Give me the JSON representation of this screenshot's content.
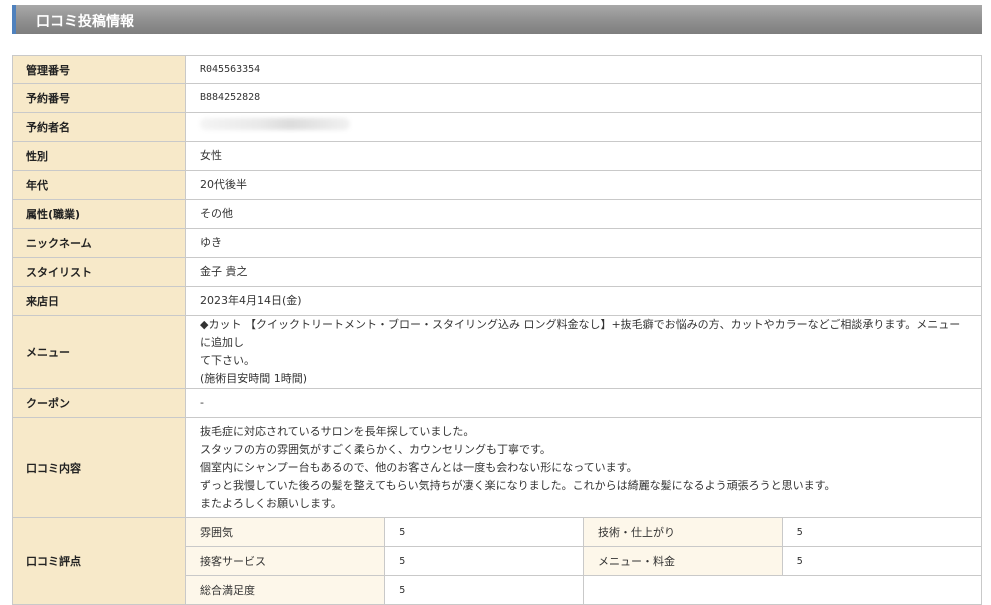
{
  "header": {
    "title": "口コミ投稿情報"
  },
  "rows": {
    "kanri": {
      "label": "管理番号",
      "value": "R045563354"
    },
    "yoyaku_no": {
      "label": "予約番号",
      "value": "B884252828"
    },
    "yoyaku_name": {
      "label": "予約者名"
    },
    "gender": {
      "label": "性別",
      "value": "女性"
    },
    "age": {
      "label": "年代",
      "value": "20代後半"
    },
    "occupation": {
      "label": "属性(職業)",
      "value": "その他"
    },
    "nickname": {
      "label": "ニックネーム",
      "value": "ゆき"
    },
    "stylist": {
      "label": "スタイリスト",
      "value": "金子 貴之"
    },
    "visit_date": {
      "label": "来店日",
      "value": "2023年4月14日(金)"
    },
    "menu": {
      "label": "メニュー",
      "line1": "◆カット 【クイックトリートメント・ブロー・スタイリング込み ロング料金なし】+抜毛癖でお悩みの方、カットやカラーなどご相談承ります。メニューに追加し",
      "line2": "て下さい。",
      "line3": "(施術目安時間 1時間)"
    },
    "coupon": {
      "label": "クーポン",
      "value": "-"
    },
    "review": {
      "label": "口コミ内容",
      "lines": [
        "抜毛症に対応されているサロンを長年探していました。",
        "スタッフの方の雰囲気がすごく柔らかく、カウンセリングも丁寧です。",
        "個室内にシャンプー台もあるので、他のお客さんとは一度も会わない形になっています。",
        "ずっと我慢していた後ろの髪を整えてもらい気持ちが凄く楽になりました。これからは綺麗な髪になるよう頑張ろうと思います。",
        "またよろしくお願いします。"
      ]
    },
    "ratings": {
      "label": "口コミ評点",
      "atmosphere": {
        "label": "雰囲気",
        "value": "5"
      },
      "technique": {
        "label": "技術・仕上がり",
        "value": "5"
      },
      "service": {
        "label": "接客サービス",
        "value": "5"
      },
      "menu_price": {
        "label": "メニュー・料金",
        "value": "5"
      },
      "overall": {
        "label": "総合満足度",
        "value": "5"
      }
    }
  }
}
